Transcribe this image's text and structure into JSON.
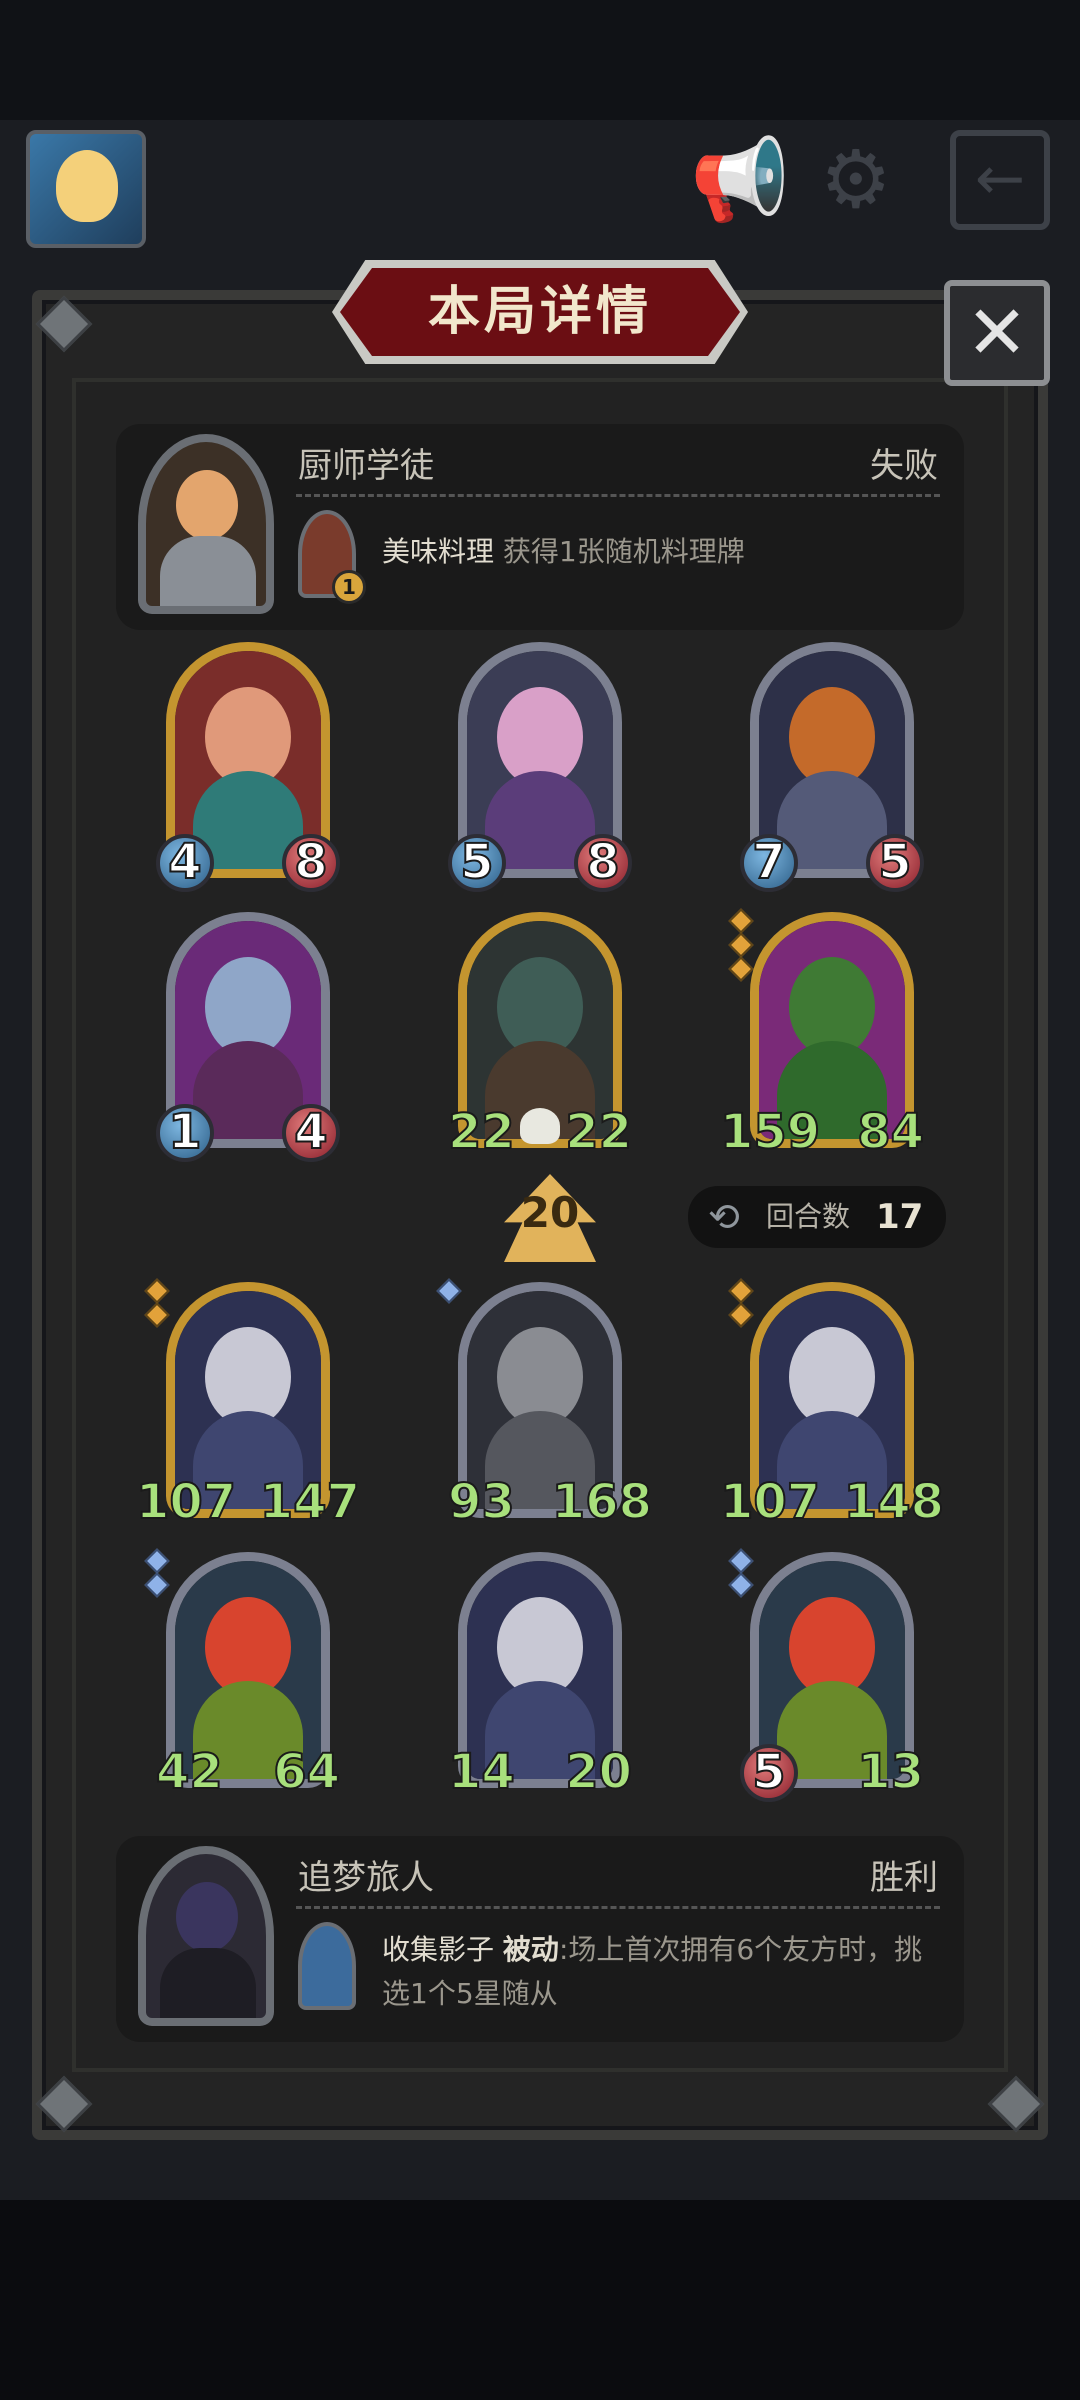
{
  "header": {
    "title": "本局详情",
    "close_symbol": "✕",
    "icons": [
      "avatar-portrait",
      "megaphone-icon",
      "gear-icon",
      "exit-icon"
    ]
  },
  "opponent": {
    "name": "厨师学徒",
    "result": "失败",
    "skill_level": "1",
    "skill_name": "美味料理",
    "skill_desc": " 获得1张随机料理牌"
  },
  "opponent_board": [
    {
      "atk": "4",
      "hp": "8"
    },
    {
      "atk": "5",
      "hp": "8"
    },
    {
      "atk": "7",
      "hp": "5"
    },
    {
      "atk": "1",
      "hp": "4"
    },
    {
      "atk": "22",
      "hp": "22"
    },
    {
      "atk": "159",
      "hp": "84"
    }
  ],
  "middle": {
    "tavern_tier": "20",
    "turns_label": "回合数",
    "turns_value": "17"
  },
  "player_board": [
    {
      "atk": "107",
      "hp": "147"
    },
    {
      "atk": "93",
      "hp": "168"
    },
    {
      "atk": "107",
      "hp": "148"
    },
    {
      "atk": "42",
      "hp": "64"
    },
    {
      "atk": "14",
      "hp": "20"
    },
    {
      "atk": "5",
      "hp": "13"
    }
  ],
  "player": {
    "name": "追梦旅人",
    "result": "胜利",
    "skill_name": "收集影子",
    "skill_tag": "被动",
    "skill_desc": ":场上首次拥有6个友方时，挑选1个5星随从"
  }
}
